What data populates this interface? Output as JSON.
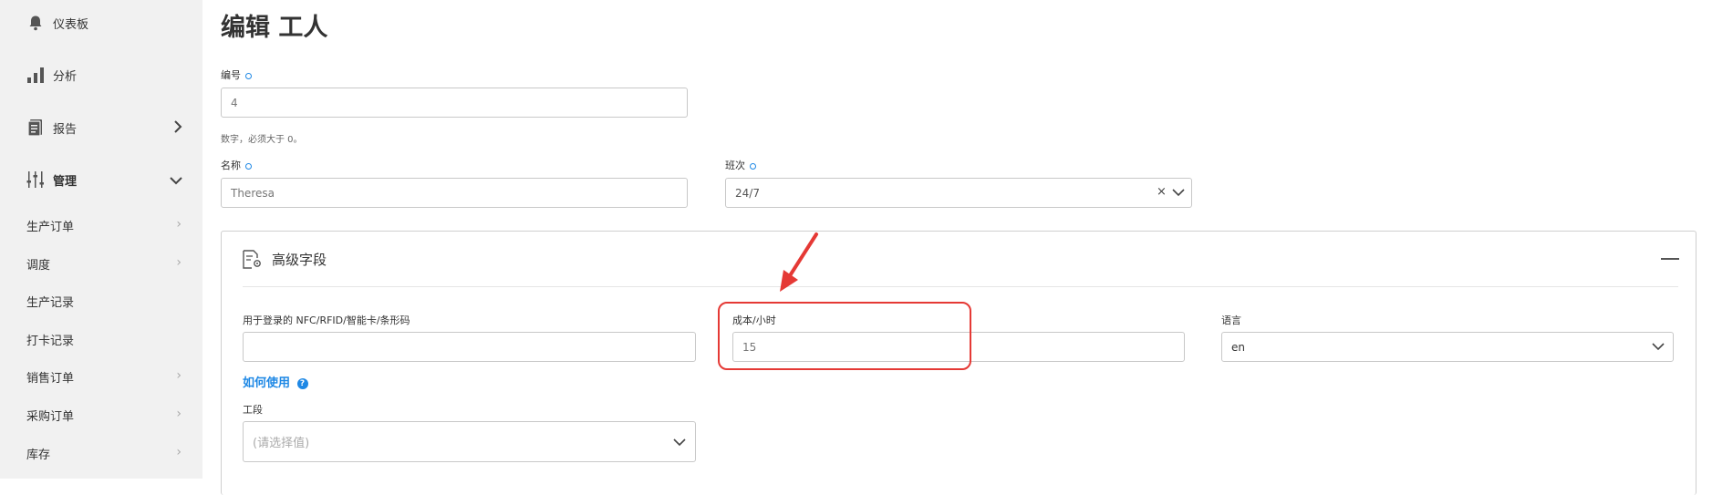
{
  "sidebar": {
    "top_items": [
      {
        "label": "仪表板",
        "icon": "bell-icon"
      },
      {
        "label": "分析",
        "icon": "bar-chart-icon"
      },
      {
        "label": "报告",
        "icon": "document-icon"
      },
      {
        "label": "管理",
        "icon": "sliders-icon"
      }
    ],
    "sub_items": [
      {
        "label": "生产订单"
      },
      {
        "label": "调度"
      },
      {
        "label": "生产记录"
      },
      {
        "label": "打卡记录"
      },
      {
        "label": "销售订单"
      },
      {
        "label": "采购订单"
      },
      {
        "label": "库存"
      }
    ]
  },
  "page": {
    "title": "编辑 工人"
  },
  "form": {
    "number": {
      "label": "编号",
      "value": "4",
      "hint": "数字，必须大于 0。"
    },
    "name": {
      "label": "名称",
      "value": "Theresa"
    },
    "shift": {
      "label": "班次",
      "value": "24/7"
    }
  },
  "advanced": {
    "title": "高级字段",
    "nfc": {
      "label": "用于登录的 NFC/RFID/智能卡/条形码",
      "value": "",
      "help_link": "如何使用"
    },
    "cost": {
      "label": "成本/小时",
      "value": "15"
    },
    "language": {
      "label": "语言",
      "value": "en"
    },
    "workstation": {
      "label": "工段",
      "placeholder": "(请选择值)"
    }
  },
  "colors": {
    "accent": "#1e88e5",
    "annotation": "#e53935"
  }
}
